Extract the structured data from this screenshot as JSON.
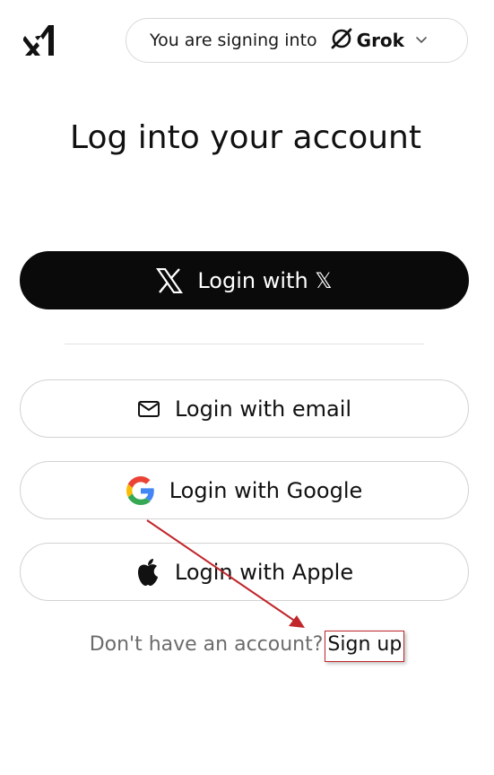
{
  "header": {
    "signing_prefix": "You are signing into",
    "product_name": "Grok"
  },
  "title": "Log into your account",
  "buttons": {
    "x_prefix": "Login with",
    "x_symbol": "𝕏",
    "email": "Login with email",
    "google": "Login with Google",
    "apple": "Login with Apple"
  },
  "footer": {
    "prompt": "Don't have an account?",
    "signup": "Sign up"
  },
  "colors": {
    "primary_button": "#0a0a0a",
    "annotation_red": "#c0262b",
    "google_blue": "#4285F4",
    "google_red": "#EA4335",
    "google_yellow": "#FBBC05",
    "google_green": "#34A853"
  },
  "icons": [
    "xai-logo-icon",
    "grok-logo-icon",
    "chevron-down-icon",
    "x-logo-icon",
    "mail-icon",
    "google-logo-icon",
    "apple-logo-icon"
  ]
}
